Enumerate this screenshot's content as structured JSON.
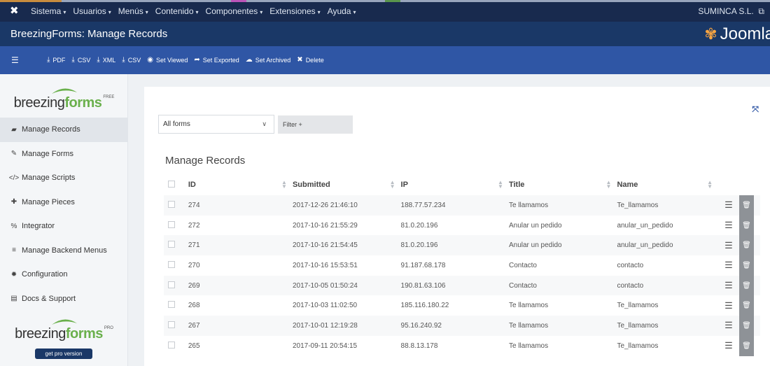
{
  "system_bar": {
    "menu": [
      "Sistema",
      "Usuarios",
      "Menús",
      "Contenido",
      "Componentes",
      "Extensiones",
      "Ayuda"
    ],
    "site_name": "SUMINCA S.L."
  },
  "header": {
    "title": "BreezingForms: Manage Records",
    "brand": "Joomla"
  },
  "toolbar": {
    "buttons": [
      {
        "label": "PDF",
        "icon": "download-icon"
      },
      {
        "label": "CSV",
        "icon": "download-icon"
      },
      {
        "label": "XML",
        "icon": "download-icon"
      },
      {
        "label": "CSV",
        "icon": "download-icon"
      },
      {
        "label": "Set Viewed",
        "icon": "eye-icon"
      },
      {
        "label": "Set Exported",
        "icon": "share-icon"
      },
      {
        "label": "Set Archived",
        "icon": "cloud-icon"
      },
      {
        "label": "Delete",
        "icon": "close-icon"
      }
    ]
  },
  "sidebar": {
    "logo_word_a": "breezing",
    "logo_word_b": "forms",
    "logo_tag_free": "FREE",
    "logo_tag_pro": "PRO",
    "pro_button": "get pro version",
    "items": [
      {
        "label": "Manage Records",
        "icon": "folder-open-icon",
        "active": true
      },
      {
        "label": "Manage Forms",
        "icon": "edit-icon",
        "active": false
      },
      {
        "label": "Manage Scripts",
        "icon": "code-icon",
        "active": false
      },
      {
        "label": "Manage Pieces",
        "icon": "puzzle-icon",
        "active": false
      },
      {
        "label": "Integrator",
        "icon": "link-icon",
        "active": false
      },
      {
        "label": "Manage Backend Menus",
        "icon": "menu-icon",
        "active": false
      },
      {
        "label": "Configuration",
        "icon": "gear-icon",
        "active": false
      },
      {
        "label": "Docs & Support",
        "icon": "document-icon",
        "active": false
      }
    ]
  },
  "main": {
    "form_select": {
      "value": "All forms"
    },
    "filter_label": "Filter +",
    "section_title": "Manage Records",
    "columns": [
      "ID",
      "Submitted",
      "IP",
      "Title",
      "Name"
    ],
    "rows": [
      {
        "id": "274",
        "submitted": "2017-12-26 21:46:10",
        "ip": "188.77.57.234",
        "title": "Te llamamos",
        "name": "Te_llamamos"
      },
      {
        "id": "272",
        "submitted": "2017-10-16 21:55:29",
        "ip": "81.0.20.196",
        "title": "Anular un pedido",
        "name": "anular_un_pedido"
      },
      {
        "id": "271",
        "submitted": "2017-10-16 21:54:45",
        "ip": "81.0.20.196",
        "title": "Anular un pedido",
        "name": "anular_un_pedido"
      },
      {
        "id": "270",
        "submitted": "2017-10-16 15:53:51",
        "ip": "91.187.68.178",
        "title": "Contacto",
        "name": "contacto"
      },
      {
        "id": "269",
        "submitted": "2017-10-05 01:50:24",
        "ip": "190.81.63.106",
        "title": "Contacto",
        "name": "contacto"
      },
      {
        "id": "268",
        "submitted": "2017-10-03 11:02:50",
        "ip": "185.116.180.22",
        "title": "Te llamamos",
        "name": "Te_llamamos"
      },
      {
        "id": "267",
        "submitted": "2017-10-01 12:19:28",
        "ip": "95.16.240.92",
        "title": "Te llamamos",
        "name": "Te_llamamos"
      },
      {
        "id": "265",
        "submitted": "2017-09-11 20:54:15",
        "ip": "88.8.13.178",
        "title": "Te llamamos",
        "name": "Te_llamamos"
      }
    ]
  },
  "colors": {
    "system_bar": "#182a4e",
    "header": "#1a3867",
    "toolbar": "#2f56a5",
    "accent_green": "#6ab04c",
    "joomla_orange": "#f9a541"
  }
}
